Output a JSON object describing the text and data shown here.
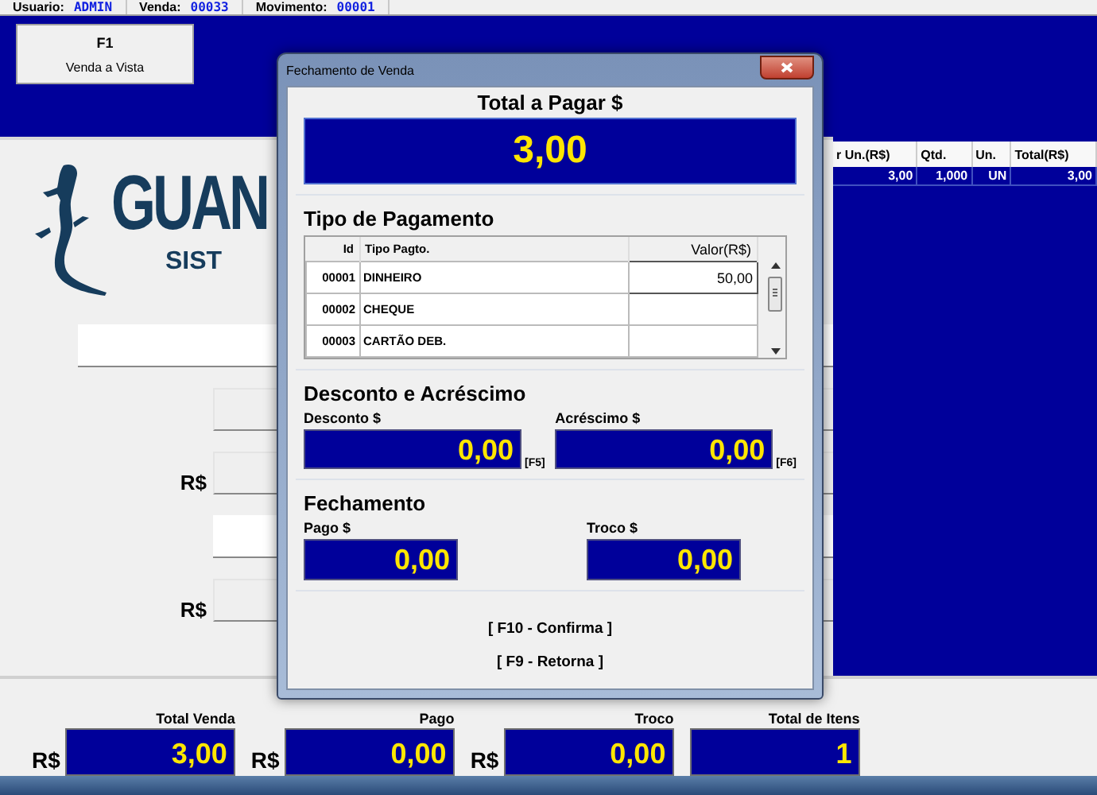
{
  "header": {
    "fields": [
      {
        "label": "Usuario:",
        "value": "ADMIN"
      },
      {
        "label": "Venda:",
        "value": "00033"
      },
      {
        "label": "Movimento:",
        "value": "00001"
      }
    ]
  },
  "shortcut_buttons": [
    {
      "key": "F1",
      "label": "Venda a Vista"
    }
  ],
  "logo": {
    "text": "GUAN",
    "subtext": "SIST"
  },
  "form_fields": [
    {
      "kind": "wide",
      "disabled": false
    },
    {
      "kind": "short",
      "disabled": true
    },
    {
      "kind": "short",
      "disabled": true,
      "prefix": "R$"
    },
    {
      "kind": "short",
      "disabled": false
    },
    {
      "kind": "short",
      "disabled": true,
      "prefix": "R$"
    }
  ],
  "items_table": {
    "columns": [
      "r Un.(R$)",
      "Qtd.",
      "Un.",
      "Total(R$)"
    ],
    "rows": [
      [
        "3,00",
        "1,000",
        "UN",
        "3,00"
      ]
    ]
  },
  "totals": [
    {
      "label": "Total Venda",
      "currency": "R$",
      "value": "3,00"
    },
    {
      "label": "Pago",
      "currency": "R$",
      "value": "0,00"
    },
    {
      "label": "Troco",
      "currency": "R$",
      "value": "0,00"
    },
    {
      "label": "Total de Itens",
      "value": "1"
    }
  ],
  "dialog": {
    "title": "Fechamento de Venda",
    "total_label": "Total a Pagar $",
    "total_value": "3,00",
    "payment": {
      "heading": "Tipo de Pagamento",
      "columns": [
        "Id",
        "Tipo Pagto.",
        "Valor(R$)"
      ],
      "rows": [
        {
          "id": "00001",
          "type": "DINHEIRO",
          "value": "50,00",
          "selected": true
        },
        {
          "id": "00002",
          "type": "CHEQUE",
          "selected": false
        },
        {
          "id": "00003",
          "type": "CARTÃO DEB.",
          "selected": false
        }
      ]
    },
    "adjustments": {
      "heading": "Desconto e Acréscimo",
      "fields": [
        {
          "label": "Desconto $",
          "value": "0,00",
          "shortcut": "[F5]"
        },
        {
          "label": "Acréscimo $",
          "value": "0,00",
          "shortcut": "[F6]"
        }
      ]
    },
    "closing": {
      "heading": "Fechamento",
      "fields": [
        {
          "label": "Pago $",
          "value": "0,00"
        },
        {
          "label": "Troco $",
          "value": "0,00"
        }
      ]
    },
    "actions": [
      "[ F10 - Confirma ]",
      "[ F9 - Retorna ]"
    ]
  }
}
